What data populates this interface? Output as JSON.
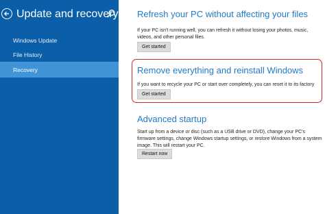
{
  "sidebar": {
    "title": "Update and recovery",
    "items": [
      {
        "label": "Windows Update",
        "selected": false
      },
      {
        "label": "File History",
        "selected": false
      },
      {
        "label": "Recovery",
        "selected": true
      }
    ]
  },
  "sections": {
    "refresh": {
      "heading": "Refresh your PC without affecting your files",
      "description": "If your PC isn't running well, you can refresh it without losing your photos, music, videos, and other personal files.",
      "button": "Get started"
    },
    "reset": {
      "heading": "Remove everything and reinstall Windows",
      "description": "If you want to recycle your PC or start over completely, you can reset it to its factory settings.",
      "button": "Get started"
    },
    "advanced": {
      "heading": "Advanced startup",
      "description": "Start up from a device or disc (such as a USB drive or DVD), change your PC's firmware settings, change Windows startup settings, or restore Windows from a system image. This will restart your PC.",
      "button": "Restart now"
    }
  },
  "colors": {
    "sidebar_bg": "#0b5ea8",
    "selected_item": "#3f95d7",
    "heading_blue": "#1f7ac8",
    "highlight_red": "#d4232a"
  },
  "icons": [
    "back-arrow-icon",
    "search-icon"
  ]
}
